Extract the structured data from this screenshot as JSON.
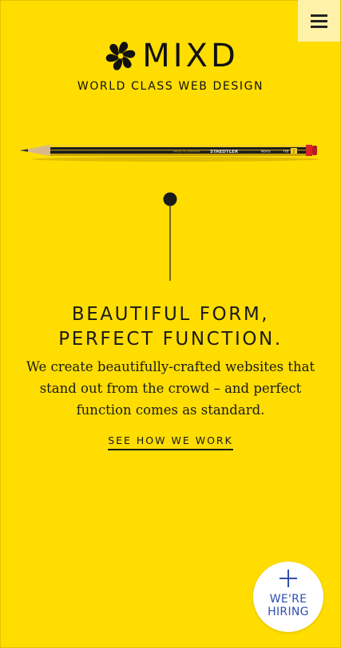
{
  "header": {
    "menu_icon": "hamburger-icon",
    "logo_icon": "mixd-flower-icon",
    "brand": "MIXD",
    "tagline": "WORLD CLASS WEB DESIGN"
  },
  "hero": {
    "pencil_brand": "STAEDTLER",
    "pencil_model": "Noris",
    "pencil_grade": "HB",
    "pencil_grade_number": "2",
    "pencil_made_in": "MADE IN GERMANY",
    "headline_line1": "BEAUTIFUL FORM,",
    "headline_line2": "PERFECT FUNCTION.",
    "intro_line1": "We create beautifully-crafted websites that",
    "intro_line2": "stand out from the crowd – and perfect",
    "intro_line3": "function comes as standard.",
    "cta_label": "SEE HOW WE WORK"
  },
  "hiring": {
    "icon": "plus-icon",
    "line1": "WE'RE",
    "line2": "HIRING"
  },
  "colors": {
    "background": "#FFDD00",
    "menu_background": "#FFF2A8",
    "text": "#1A1A1A",
    "hiring_text": "#2F4FB0"
  }
}
